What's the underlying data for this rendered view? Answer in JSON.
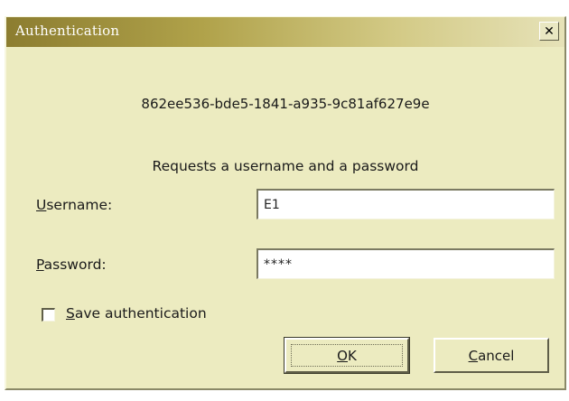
{
  "window": {
    "title": "Authentication"
  },
  "header": {
    "uuid": "862ee536-bde5-1841-a935-9c81af627e9e",
    "prompt": "Requests a username and a password"
  },
  "username": {
    "label_mnemonic": "U",
    "label_rest": "sername:",
    "value": "E1"
  },
  "password": {
    "label_mnemonic": "P",
    "label_rest": "assword:",
    "value": "****"
  },
  "save": {
    "label_mnemonic": "S",
    "label_rest": "ave authentication",
    "checked": false
  },
  "buttons": {
    "ok_mnemonic": "O",
    "ok_rest": "K",
    "cancel_mnemonic": "C",
    "cancel_rest": "ancel"
  },
  "icons": {
    "close": "close-icon"
  },
  "colors": {
    "window_bg": "#ecebc0",
    "titlebar_start": "#8c7d30",
    "titlebar_end": "#e6e2b8"
  }
}
